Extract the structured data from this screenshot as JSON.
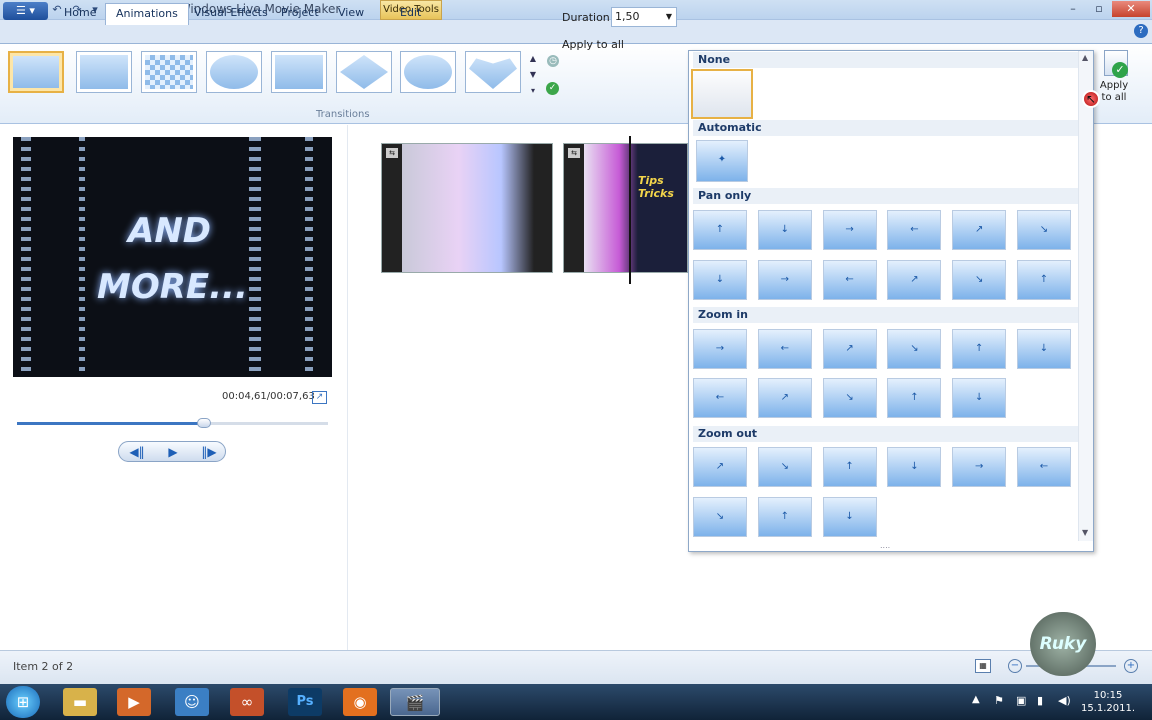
{
  "window": {
    "title": "My Movie - Windows Live Movie Maker",
    "context_tab": "Video Tools"
  },
  "tabs": [
    "Home",
    "Animations",
    "Visual Effects",
    "Project",
    "View",
    "Edit"
  ],
  "ribbon": {
    "group_label": "Transitions",
    "duration_label": "Duration:",
    "duration_value": "1,50",
    "apply_all_small": "Apply to all",
    "apply_all_big": "Apply to all"
  },
  "preview": {
    "overlay_lines": [
      "AND",
      "MORE..."
    ],
    "timecode": "00:04,61/00:07,63",
    "progress": 0.6
  },
  "storyboard": {
    "clip2_text": "Tips Tricks"
  },
  "gallery": {
    "sections": [
      "None",
      "Automatic",
      "Pan only",
      "Zoom in",
      "Zoom out"
    ]
  },
  "status": {
    "text": "Item 2 of 2"
  },
  "taskbar": {
    "time": "10:15",
    "date": "15.1.2011."
  },
  "watermark": {
    "text": "Ruky"
  },
  "colors": {
    "accent": "#3c76c2",
    "selection": "#e7b145"
  }
}
